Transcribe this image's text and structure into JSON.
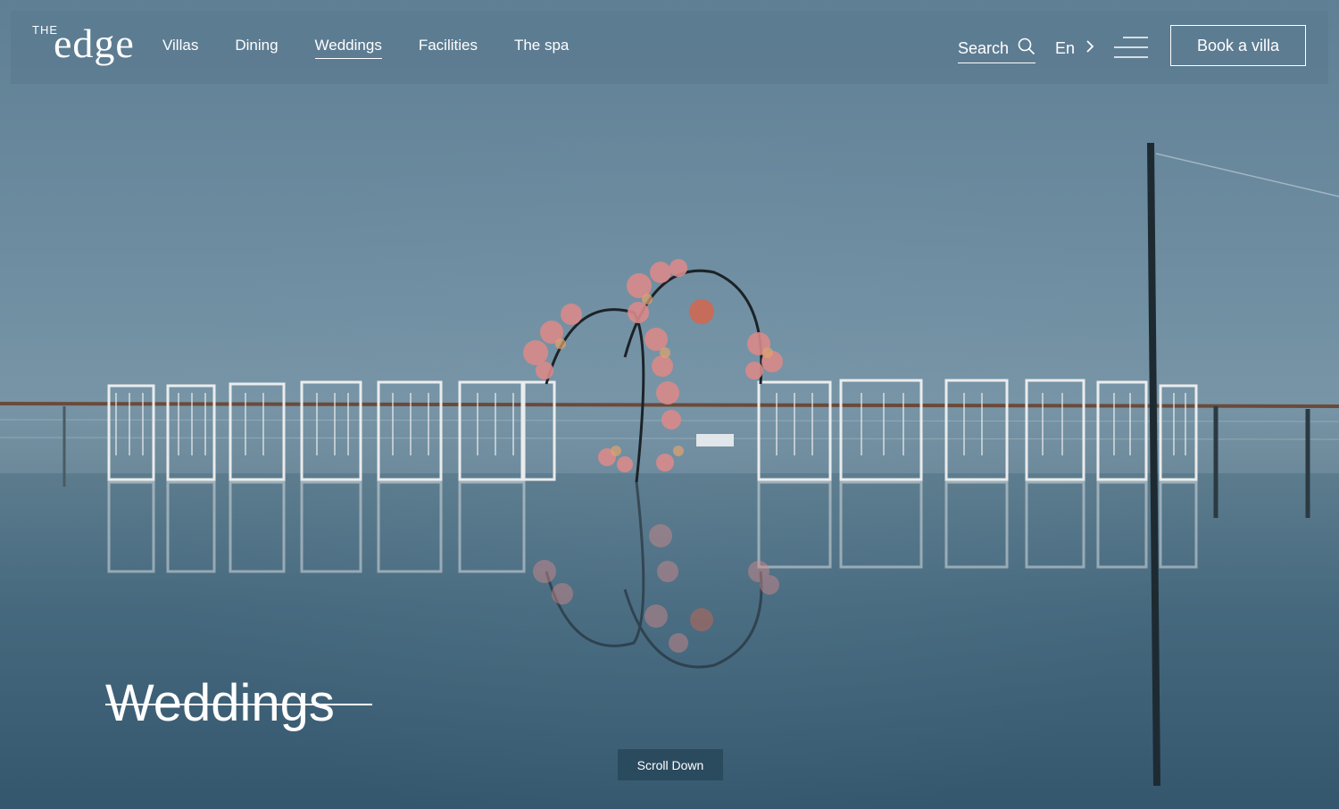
{
  "brand": {
    "the": "THE",
    "name": "edge"
  },
  "nav": {
    "items": [
      {
        "label": "Villas",
        "active": false
      },
      {
        "label": "Dining",
        "active": false
      },
      {
        "label": "Weddings",
        "active": true
      },
      {
        "label": "Facilities",
        "active": false
      },
      {
        "label": "The spa",
        "active": false
      }
    ],
    "search_label": "Search",
    "language": "En",
    "book_label": "Book a villa"
  },
  "hero": {
    "title": "Weddings",
    "scroll_label": "Scroll Down"
  },
  "colors": {
    "overlay": "#5a788e",
    "text": "#ffffff",
    "button_bg": "#284659"
  }
}
